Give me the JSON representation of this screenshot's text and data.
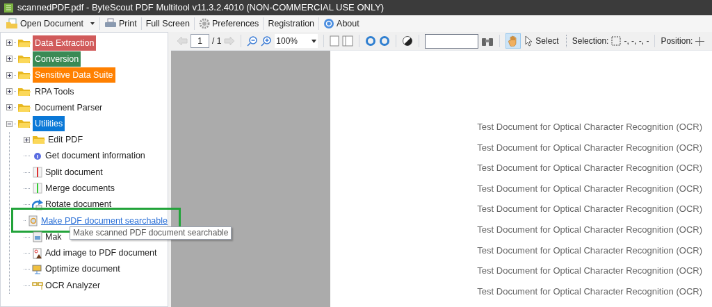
{
  "window": {
    "title": "scannedPDF.pdf - ByteScout PDF Multitool v11.3.2.4010 (NON-COMMERCIAL USE ONLY)"
  },
  "toolbar": [
    {
      "kind": "open",
      "label": "Open Document"
    },
    {
      "kind": "print",
      "label": "Print"
    },
    {
      "kind": "plain",
      "label": "Full Screen"
    },
    {
      "kind": "prefs",
      "label": "Preferences"
    },
    {
      "kind": "plain",
      "label": "Registration"
    },
    {
      "kind": "about",
      "label": "About"
    }
  ],
  "tree": [
    {
      "label": "Data Extraction",
      "color": "#d15b5b",
      "selected": false,
      "expanded": false
    },
    {
      "label": "Conversion",
      "color": "#3a8a55",
      "selected": false,
      "expanded": false
    },
    {
      "label": "Sensitive Data Suite",
      "color": "#ff8000",
      "selected": false,
      "expanded": false
    },
    {
      "label": "RPA Tools",
      "selected": false,
      "expanded": false
    },
    {
      "label": "Document Parser",
      "selected": false,
      "expanded": false
    },
    {
      "label": "Utilities",
      "selected": true,
      "expanded": true,
      "children": [
        {
          "kind": "folder",
          "label": "Edit PDF",
          "expanded": false,
          "hovered": false
        },
        {
          "kind": "info",
          "label": "Get document information",
          "hovered": false
        },
        {
          "kind": "split",
          "label": "Split document",
          "hovered": false
        },
        {
          "kind": "merge",
          "label": "Merge documents",
          "hovered": false
        },
        {
          "kind": "rotate",
          "label": "Rotate document",
          "hovered": false
        },
        {
          "kind": "searchable",
          "label": "Make PDF document searchable",
          "hovered": true
        },
        {
          "kind": "scan",
          "label": "Mak",
          "hovered": false,
          "tooltip": "Make scanned PDF document searchable"
        },
        {
          "kind": "image",
          "label": "Add image to PDF document",
          "hovered": false
        },
        {
          "kind": "optimize",
          "label": "Optimize document",
          "hovered": false
        },
        {
          "kind": "ocr",
          "label": "OCR Analyzer",
          "hovered": false
        }
      ]
    }
  ],
  "viewer_toolbar": {
    "page": "1",
    "page_count": "/ 1",
    "zoom": "100%",
    "hand_tool": {
      "selected": true
    },
    "select_tool": {
      "label": "Select",
      "selected": false
    },
    "selection_label": "Selection:",
    "selection_value": "-, -, -, -",
    "position_label": "Position:"
  },
  "document": {
    "lines": [
      "Test Document for Optical Character Recognition (OCR)",
      "Test Document for Optical Character Recognition (OCR)",
      "Test Document for Optical Character Recognition (OCR)",
      "Test Document for Optical Character Recognition (OCR)",
      "Test Document for Optical Character Recognition (OCR)",
      "Test Document for Optical Character Recognition (OCR)",
      "Test Document for Optical Character Recognition (OCR)",
      "Test Document for Optical Character Recognition (OCR)",
      "Test Document for Optical Character Recognition (OCR)"
    ]
  }
}
